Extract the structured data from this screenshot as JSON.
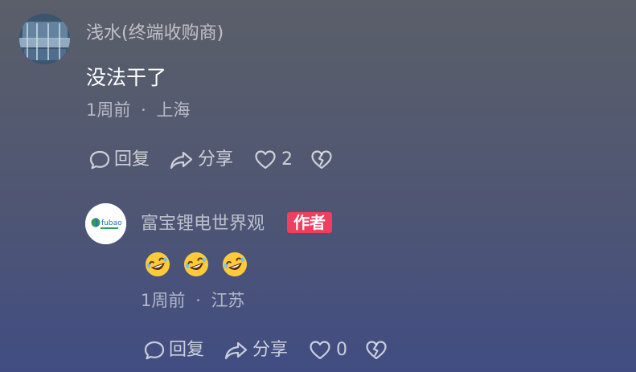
{
  "comments": [
    {
      "username": "浅水(终端收购商)",
      "text": "没法干了",
      "time": "1周前",
      "separator": "·",
      "location": "上海",
      "actions": {
        "reply": "回复",
        "share": "分享",
        "likes": "2"
      }
    }
  ],
  "replies": [
    {
      "username": "富宝锂电世界观",
      "badge": "作者",
      "logo_text": "fubao",
      "emoji_count": 3,
      "emoji_name": "rolling-on-floor-laughing",
      "time": "1周前",
      "separator": "·",
      "location": "江苏",
      "actions": {
        "reply": "回复",
        "share": "分享",
        "likes": "0"
      }
    }
  ],
  "colors": {
    "badge": "#f03e5f",
    "background_top": "#5b5f69",
    "background_bottom": "#414d82"
  }
}
